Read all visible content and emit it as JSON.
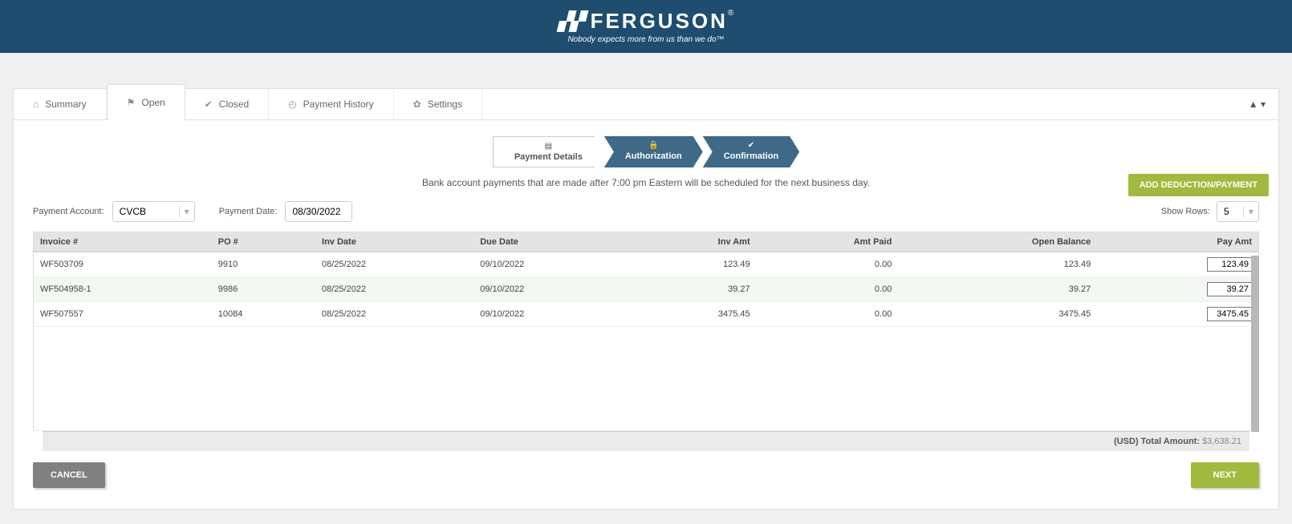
{
  "brand": {
    "name": "FERGUSON",
    "tagline": "Nobody expects more from us than we do",
    "reg": "®",
    "tm": "™"
  },
  "tabs": {
    "summary": "Summary",
    "open": "Open",
    "closed": "Closed",
    "history": "Payment History",
    "settings": "Settings"
  },
  "wizard": {
    "details": "Payment Details",
    "auth": "Authorization",
    "confirm": "Confirmation"
  },
  "notice": "Bank account payments that are made after 7:00 pm Eastern will be scheduled for the next business day.",
  "buttons": {
    "add": "ADD DEDUCTION/PAYMENT",
    "cancel": "CANCEL",
    "next": "NEXT"
  },
  "controls": {
    "account_label": "Payment Account:",
    "account_value": "CVCB",
    "date_label": "Payment Date:",
    "date_value": "08/30/2022",
    "showrows_label": "Show Rows:",
    "showrows_value": "5"
  },
  "headers": {
    "invoice": "Invoice #",
    "po": "PO #",
    "invdate": "Inv Date",
    "duedate": "Due Date",
    "invamt": "Inv Amt",
    "amtpaid": "Amt Paid",
    "openbal": "Open Balance",
    "payamt": "Pay Amt"
  },
  "rows": [
    {
      "invoice": "WF503709",
      "po": "9910",
      "invdate": "08/25/2022",
      "duedate": "09/10/2022",
      "invamt": "123.49",
      "amtpaid": "0.00",
      "openbal": "123.49",
      "payamt": "123.49"
    },
    {
      "invoice": "WF504958-1",
      "po": "9986",
      "invdate": "08/25/2022",
      "duedate": "09/10/2022",
      "invamt": "39.27",
      "amtpaid": "0.00",
      "openbal": "39.27",
      "payamt": "39.27"
    },
    {
      "invoice": "WF507557",
      "po": "10084",
      "invdate": "08/25/2022",
      "duedate": "09/10/2022",
      "invamt": "3475.45",
      "amtpaid": "0.00",
      "openbal": "3475.45",
      "payamt": "3475.45"
    }
  ],
  "total": {
    "label": "(USD) Total Amount: ",
    "value": "$3,638.21"
  }
}
